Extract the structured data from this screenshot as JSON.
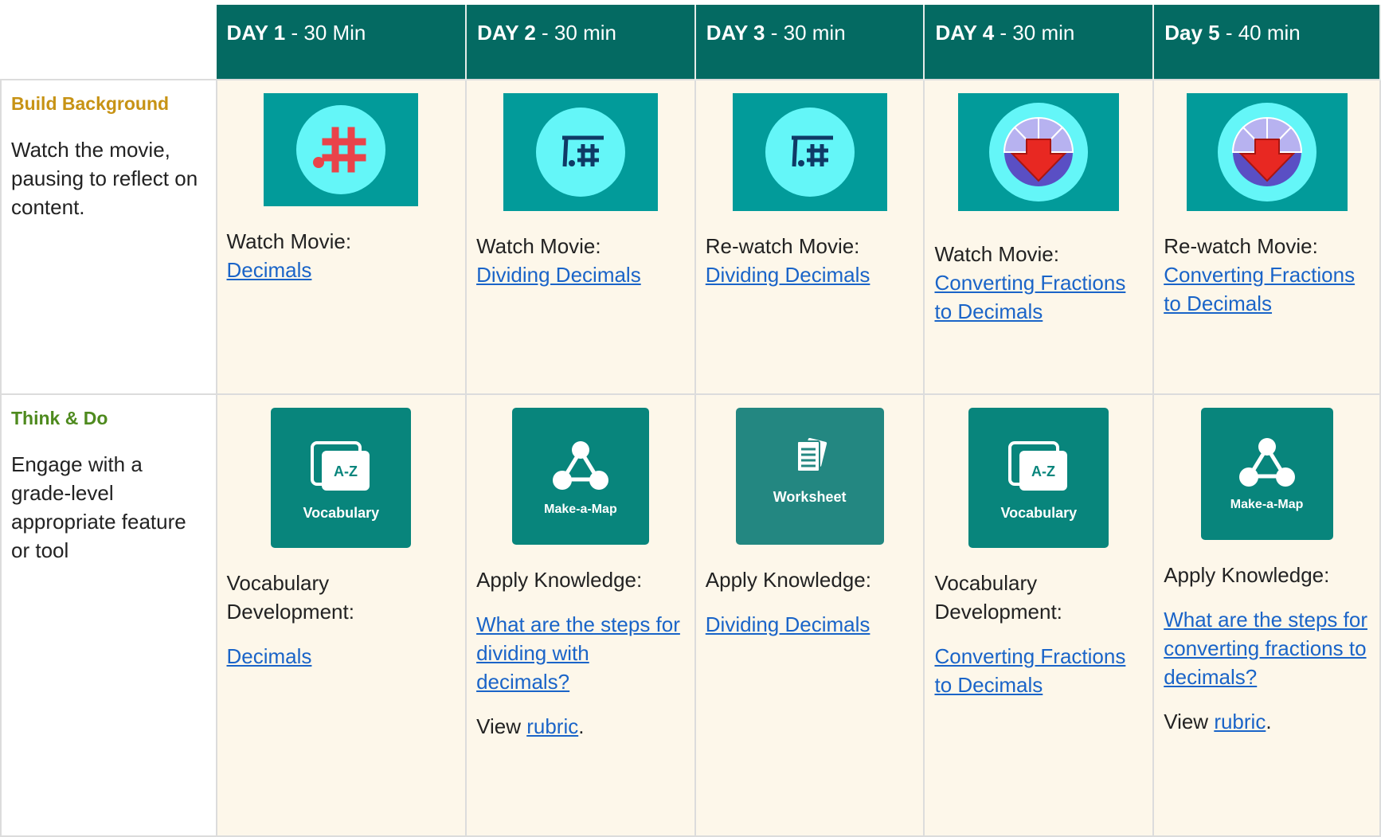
{
  "days": [
    {
      "day": "DAY 1",
      "duration": "  - 30 Min"
    },
    {
      "day": "DAY 2",
      "duration": " - 30 min"
    },
    {
      "day": "DAY 3",
      "duration": " - 30 min"
    },
    {
      "day": "DAY 4",
      "duration": " - 30 min"
    },
    {
      "day": "Day 5",
      "duration": " - 40 min"
    }
  ],
  "rows": {
    "build": {
      "title": "Build Background",
      "title_color": "#c79315",
      "desc": "Watch the movie, pausing to reflect on content.",
      "cells": [
        {
          "icon": "hashtag-movie-icon",
          "prefix": "Watch Movie:",
          "link": "Decimals"
        },
        {
          "icon": "dividing-decimals-movie-icon",
          "prefix": "Watch Movie:",
          "link": "Dividing Decimals"
        },
        {
          "icon": "dividing-decimals-movie-icon",
          "prefix": "Re-watch Movie:",
          "link": "Dividing Decimals"
        },
        {
          "icon": "fraction-pie-movie-icon",
          "prefix": "Watch Movie:",
          "link": "Converting Fractions to Decimals"
        },
        {
          "icon": "fraction-pie-movie-icon",
          "prefix": "Re-watch Movie:",
          "link": "Converting Fractions to Decimals"
        }
      ]
    },
    "think": {
      "title": "Think & Do",
      "title_color": "#4e8a1e",
      "desc": "Engage with a grade-level appropriate feature or tool",
      "cells": [
        {
          "tool": "Vocabulary",
          "tool_glyph": "A-Z",
          "prefix": "Vocabulary Development:",
          "link": "Decimals"
        },
        {
          "tool": "Make-a-Map",
          "prefix": "Apply Knowledge:",
          "link": "What are the steps for dividing with decimals?",
          "view": "View ",
          "rubric": "rubric",
          "period": "."
        },
        {
          "tool": "Worksheet",
          "prefix": "Apply Knowledge:",
          "link": "Dividing Decimals"
        },
        {
          "tool": "Vocabulary",
          "tool_glyph": "A-Z",
          "prefix": "Vocabulary Development:",
          "link": "Converting Fractions to Decimals"
        },
        {
          "tool": "Make-a-Map",
          "prefix": "Apply Knowledge:",
          "link": "What are the steps for converting fractions to decimals?",
          "view": "View ",
          "rubric": "rubric",
          "period": "."
        }
      ]
    }
  },
  "colors": {
    "header_bg": "#046a62",
    "cell_bg": "#fdf7ea",
    "link": "#1a64c8",
    "thumb_bg": "#029b9a",
    "circle": "#64f6f8"
  }
}
